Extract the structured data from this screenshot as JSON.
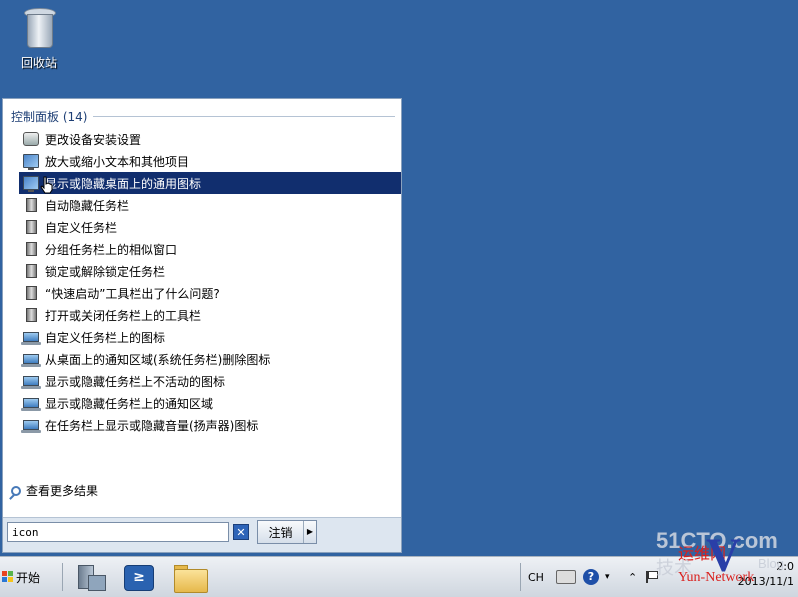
{
  "desktop": {
    "recycle_bin_label": "回收站"
  },
  "start_menu": {
    "section_title": "控制面板 (14)",
    "results": [
      {
        "label": "更改设备安装设置",
        "icon": "device-settings-icon"
      },
      {
        "label": "放大或缩小文本和其他项目",
        "icon": "display-icon"
      },
      {
        "label": "显示或隐藏桌面上的通用图标",
        "icon": "display-icon",
        "selected": true
      },
      {
        "label": "自动隐藏任务栏",
        "icon": "taskbar-icon"
      },
      {
        "label": "自定义任务栏",
        "icon": "taskbar-icon"
      },
      {
        "label": "分组任务栏上的相似窗口",
        "icon": "taskbar-icon"
      },
      {
        "label": "锁定或解除锁定任务栏",
        "icon": "taskbar-icon"
      },
      {
        "label": "“快速启动”工具栏出了什么问题?",
        "icon": "taskbar-icon"
      },
      {
        "label": "打开或关闭任务栏上的工具栏",
        "icon": "taskbar-icon"
      },
      {
        "label": "自定义任务栏上的图标",
        "icon": "notification-area-icon"
      },
      {
        "label": "从桌面上的通知区域(系统任务栏)删除图标",
        "icon": "notification-area-icon"
      },
      {
        "label": "显示或隐藏任务栏上不活动的图标",
        "icon": "notification-area-icon"
      },
      {
        "label": "显示或隐藏任务栏上的通知区域",
        "icon": "notification-area-icon"
      },
      {
        "label": "在任务栏上显示或隐藏音量(扬声器)图标",
        "icon": "notification-area-icon"
      }
    ],
    "see_more_label": "查看更多结果",
    "search": {
      "value": "icon",
      "clear_glyph": "✕"
    },
    "logoff_label": "注销",
    "logoff_arrow": "▶"
  },
  "taskbar": {
    "start_label": "开始",
    "powershell_glyph": "≥",
    "language": "CH",
    "help_glyph": "?",
    "chevron": "≈",
    "clock_time": "2:0",
    "clock_date": "2013/11/1"
  },
  "watermark": {
    "site": "51CTO.com",
    "cn_brand": "运维网",
    "blog": "Blog",
    "tech": "技术",
    "network": "Yun-Network",
    "v": "V"
  }
}
